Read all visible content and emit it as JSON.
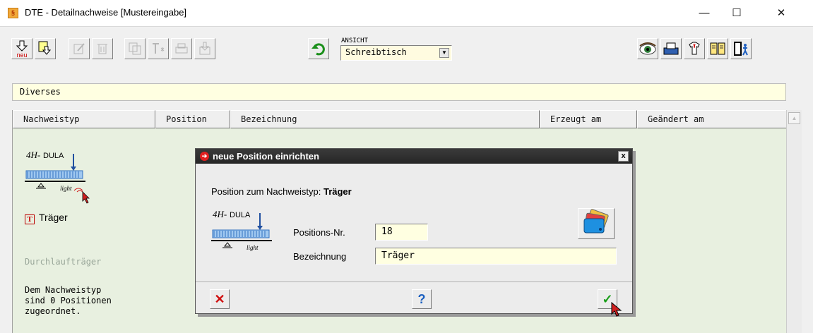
{
  "window": {
    "title": "DTE - Detailnachweise [Mustereingabe]",
    "app_icon_glyph": "§",
    "minimize_glyph": "—",
    "maximize_glyph": "☐",
    "close_glyph": "✕"
  },
  "toolbar": {
    "new_label": "neu",
    "view_label": "ANSICHT",
    "view_value": "Schreibtisch",
    "dropdown_glyph": "▼"
  },
  "category": {
    "label": "Diverses"
  },
  "table": {
    "columns": [
      "Nachweistyp",
      "Position",
      "Bezeichnung",
      "Erzeugt am",
      "Geändert am"
    ]
  },
  "left_panel": {
    "logo_text": "DULA",
    "logo_prefix": "4H-",
    "logo_light": "light",
    "type_icon_glyph": "T",
    "type_name": "Träger",
    "subtitle": "Durchlaufträger",
    "description": "Dem Nachweistyp\nsind 0 Positionen\nzugeordnet."
  },
  "dialog": {
    "title": "neue Position einrichten",
    "close_glyph": "x",
    "heading_prefix": "Position zum Nachweistyp:",
    "heading_type": "Träger",
    "posnr_label": "Positions-Nr.",
    "posnr_value": "18",
    "bezeichnung_label": "Bezeichnung",
    "bezeichnung_value": "Träger",
    "cancel_glyph": "✕",
    "help_glyph": "?",
    "ok_glyph": "✓"
  },
  "colors": {
    "table_bg": "#e8f0e0",
    "field_bg": "#ffffe1",
    "dialog_title_bg": "#2d2d2d"
  }
}
